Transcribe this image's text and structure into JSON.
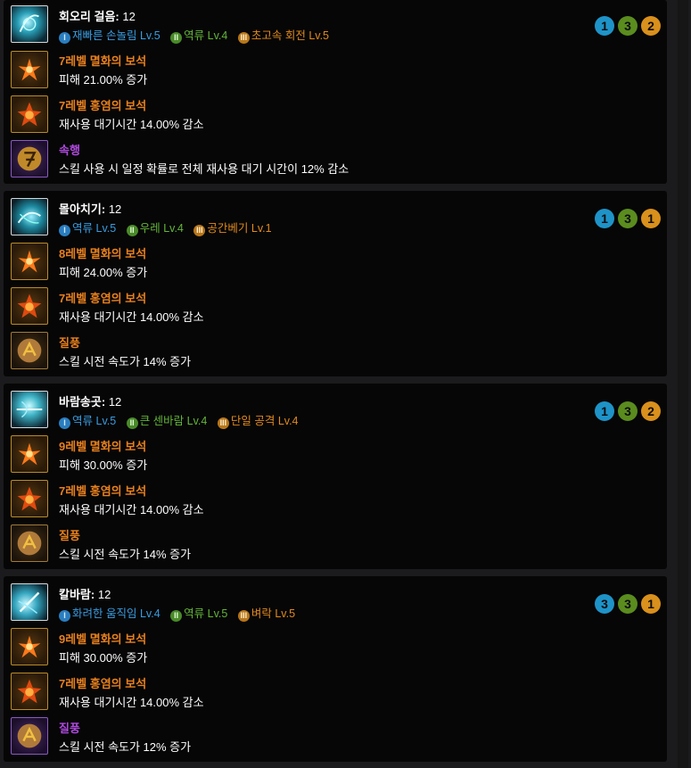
{
  "cards": [
    {
      "skill_name": "회오리 걸음",
      "level_prefix": ":",
      "level": "12",
      "tripods": [
        {
          "tier": "I",
          "name": "재빠른 손놀림",
          "lv": "Lv.5",
          "color": "#3a9ce0"
        },
        {
          "tier": "II",
          "name": "역류",
          "lv": "Lv.4",
          "color": "#64b43a"
        },
        {
          "tier": "III",
          "name": "초고속 회전",
          "lv": "Lv.5",
          "color": "#e08a1e"
        }
      ],
      "pips": [
        "1",
        "3",
        "2"
      ],
      "gem1": {
        "name": "7레벨 멸화의 보석",
        "desc": "피해 21.00% 증가"
      },
      "gem2": {
        "name": "7레벨 홍염의 보석",
        "desc": "재사용 대기시간 14.00% 감소"
      },
      "rune": {
        "name": "속행",
        "desc": "스킬 사용 시 일정 확률로 전체 재사용 대기 시간이 12% 감소",
        "icon": "rune-purple"
      }
    },
    {
      "skill_name": "몰아치기",
      "level_prefix": ":",
      "level": "12",
      "tripods": [
        {
          "tier": "I",
          "name": "역류",
          "lv": "Lv.5",
          "color": "#3a9ce0"
        },
        {
          "tier": "II",
          "name": "우레",
          "lv": "Lv.4",
          "color": "#64b43a"
        },
        {
          "tier": "III",
          "name": "공간베기",
          "lv": "Lv.1",
          "color": "#e08a1e"
        }
      ],
      "pips": [
        "1",
        "3",
        "1"
      ],
      "gem1": {
        "name": "8레벨 멸화의 보석",
        "desc": "피해 24.00% 증가"
      },
      "gem2": {
        "name": "7레벨 홍염의 보석",
        "desc": "재사용 대기시간 14.00% 감소"
      },
      "rune": {
        "name": "질풍",
        "desc": "스킬 시전 속도가 14% 증가",
        "icon": "rune-brown"
      }
    },
    {
      "skill_name": "바람송곳",
      "level_prefix": ":",
      "level": "12",
      "tripods": [
        {
          "tier": "I",
          "name": "역류",
          "lv": "Lv.5",
          "color": "#3a9ce0"
        },
        {
          "tier": "II",
          "name": "큰 센바람",
          "lv": "Lv.4",
          "color": "#64b43a"
        },
        {
          "tier": "III",
          "name": "단일 공격",
          "lv": "Lv.4",
          "color": "#e08a1e"
        }
      ],
      "pips": [
        "1",
        "3",
        "2"
      ],
      "gem1": {
        "name": "9레벨 멸화의 보석",
        "desc": "피해 30.00% 증가"
      },
      "gem2": {
        "name": "7레벨 홍염의 보석",
        "desc": "재사용 대기시간 14.00% 감소"
      },
      "rune": {
        "name": "질풍",
        "desc": "스킬 시전 속도가 14% 증가",
        "icon": "rune-brown"
      }
    },
    {
      "skill_name": "칼바람",
      "level_prefix": ":",
      "level": "12",
      "tripods": [
        {
          "tier": "I",
          "name": "화려한 움직임",
          "lv": "Lv.4",
          "color": "#3a9ce0"
        },
        {
          "tier": "II",
          "name": "역류",
          "lv": "Lv.5",
          "color": "#64b43a"
        },
        {
          "tier": "III",
          "name": "벼락",
          "lv": "Lv.5",
          "color": "#e08a1e"
        }
      ],
      "pips": [
        "3",
        "3",
        "1"
      ],
      "gem1": {
        "name": "9레벨 멸화의 보석",
        "desc": "피해 30.00% 증가"
      },
      "gem2": {
        "name": "7레벨 홍염의 보석",
        "desc": "재사용 대기시간 14.00% 감소"
      },
      "rune": {
        "name": "질풍",
        "desc": "스킬 시전 속도가 12% 증가",
        "icon": "rune-purple"
      }
    }
  ],
  "colors": {
    "tier1": "#3a9ce0",
    "tier2": "#64b43a",
    "tier3": "#e08a1e",
    "gem_name": "#e8801e",
    "rune_purple": "#b04ae0",
    "rune_brown": "#e8801e",
    "pip_blue": "#1e93c8",
    "pip_green": "#5a8c1e",
    "pip_orange": "#d9901c"
  },
  "icons": [
    "skill-icon",
    "annihilation-gem-icon",
    "crimson-flame-gem-icon",
    "rune-icon",
    "tier-badge-icon"
  ]
}
